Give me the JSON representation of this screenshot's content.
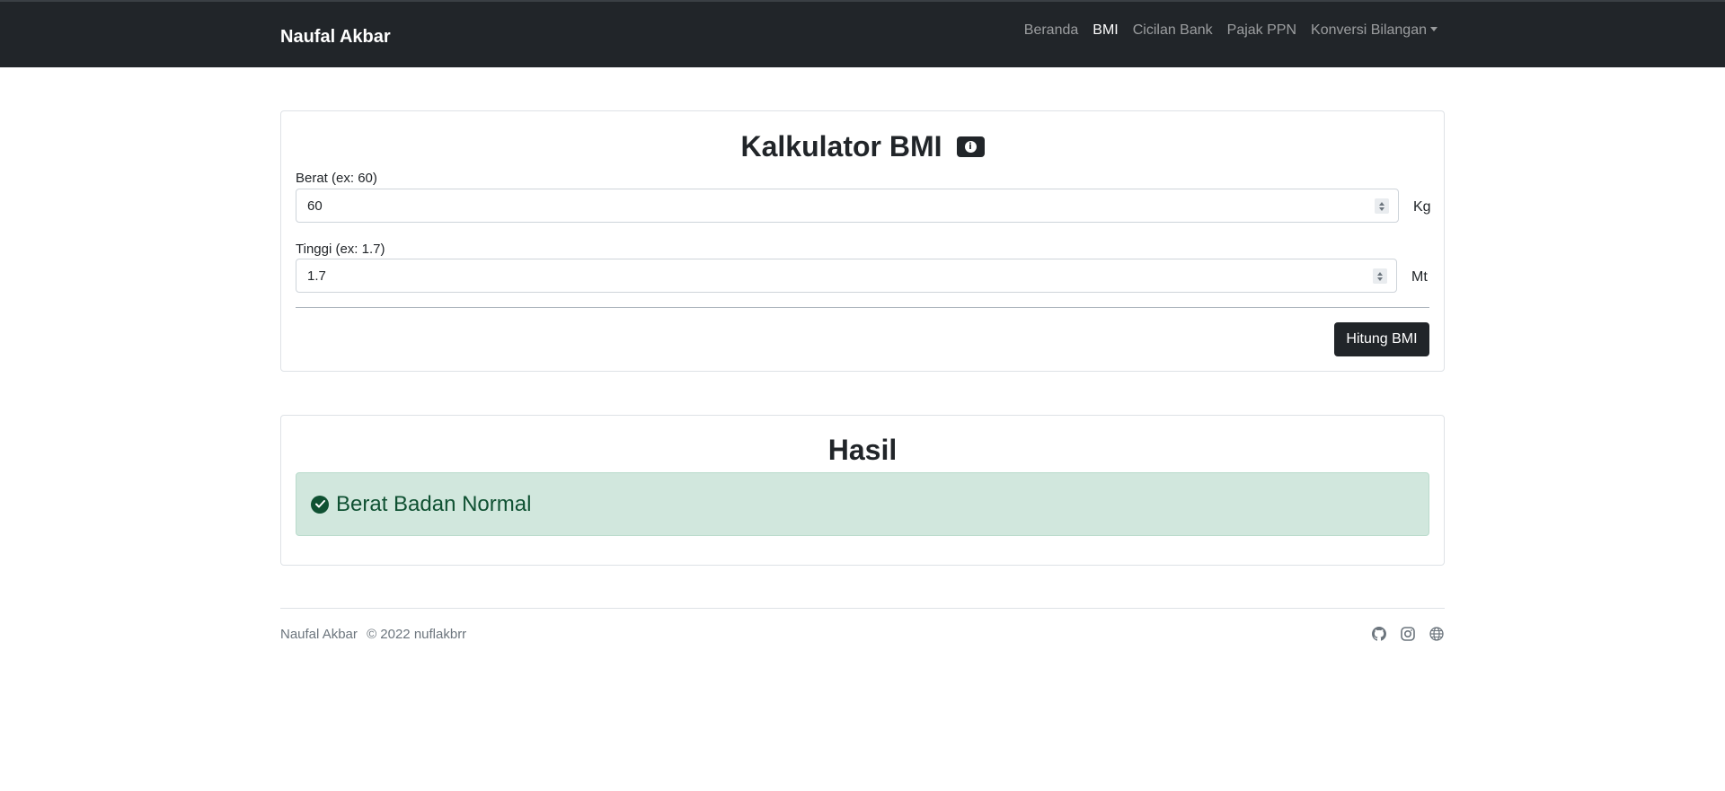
{
  "navbar": {
    "brand": "Naufal Akbar",
    "links": [
      {
        "label": "Beranda"
      },
      {
        "label": "BMI"
      },
      {
        "label": "Cicilan Bank"
      },
      {
        "label": "Pajak PPN"
      },
      {
        "label": "Konversi Bilangan"
      }
    ]
  },
  "calculator": {
    "title": "Kalkulator BMI",
    "weight": {
      "label": "Berat (ex: 60)",
      "value": "60",
      "unit": "Kg"
    },
    "height": {
      "label": "Tinggi (ex: 1.7)",
      "value": "1.7",
      "unit": "Mt"
    },
    "submit_label": "Hitung BMI"
  },
  "result": {
    "title": "Hasil",
    "status": "Berat Badan Normal"
  },
  "footer": {
    "name": "Naufal Akbar",
    "copyright": "© 2022 nuflakbrr",
    "icons": [
      "github-icon",
      "instagram-icon",
      "globe-icon"
    ]
  },
  "colors": {
    "navbar_bg": "#212529",
    "success_bg": "#d1e7dd",
    "success_text": "#0f5132"
  }
}
